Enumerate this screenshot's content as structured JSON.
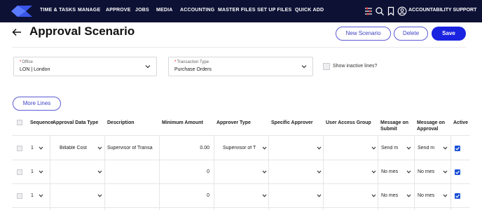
{
  "nav": {
    "items": [
      "TIME & TASKS",
      "MANAGE",
      "APPROVE",
      "JOBS",
      "MEDIA",
      "ACCOUNTING",
      "MASTER FILES",
      "SET UP FILES",
      "QUICK ADD"
    ],
    "user": "ACCOUNTABILITY SUPPORT",
    "icons": [
      "filter-icon",
      "search-icon",
      "bookmark-icon",
      "user-icon"
    ]
  },
  "header": {
    "title": "Approval Scenario",
    "new_label": "New Scenario",
    "delete_label": "Delete",
    "save_label": "Save"
  },
  "filters": {
    "office_label": "Office",
    "office_value": "LON | London",
    "transaction_label": "Transaction Type",
    "transaction_value": "Purchase Orders",
    "inactive_label": "Show inactive lines?",
    "inactive_checked": false
  },
  "more_lines_label": "More Lines",
  "grid": {
    "columns": {
      "sequence": "Sequence",
      "approval_data_type": "Approval Data Type",
      "description": "Description",
      "minimum_amount": "Minimum Amount",
      "approver_type": "Approver Type",
      "specific_approver": "Specific Approver",
      "user_access_group": "User Access Group",
      "msg_submit_1": "Message on",
      "msg_submit_2": "Submit",
      "msg_approval_1": "Message on",
      "msg_approval_2": "Approval",
      "active": "Active"
    },
    "rows": [
      {
        "sequence": "1",
        "approval_data_type": "Billable Cost",
        "description": "Supervisor of Transa",
        "minimum_amount": "0.00",
        "approver_type": "Supervisor of T",
        "specific_approver": "",
        "user_access_group": "",
        "msg_submit": "Send m",
        "msg_approval": "Send m",
        "active": true
      },
      {
        "sequence": "1",
        "approval_data_type": "",
        "description": "",
        "minimum_amount": "0",
        "approver_type": "",
        "specific_approver": "",
        "user_access_group": "",
        "msg_submit": "No mes",
        "msg_approval": "No mes",
        "active": true
      },
      {
        "sequence": "1",
        "approval_data_type": "",
        "description": "",
        "minimum_amount": "0",
        "approver_type": "",
        "specific_approver": "",
        "user_access_group": "",
        "msg_submit": "No mes",
        "msg_approval": "No mes",
        "active": true
      }
    ]
  },
  "colors": {
    "nav_bg": "#0d1134",
    "accent": "#1a23e0",
    "outline": "#5b5bd6",
    "check_active": "#1a4fd6"
  }
}
